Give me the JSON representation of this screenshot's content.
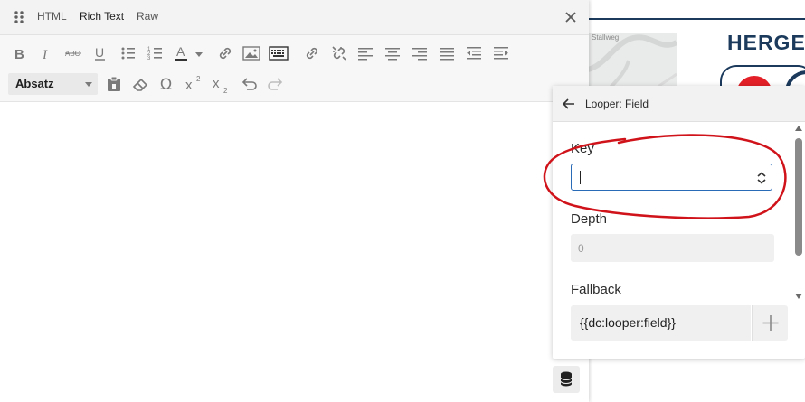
{
  "background": {
    "map_label": "Stallweg",
    "brand_text": "HERGES"
  },
  "editor": {
    "tabs": [
      {
        "label": "HTML",
        "active": false
      },
      {
        "label": "Rich Text",
        "active": true
      },
      {
        "label": "Raw",
        "active": false
      }
    ],
    "toolbar": {
      "format_select": {
        "value": "Absatz"
      },
      "row1_icons": [
        "bold-icon",
        "italic-icon",
        "strikethrough-icon",
        "underline-icon",
        "bulleted-list-icon",
        "numbered-list-icon",
        "text-color-icon",
        "link-icon",
        "image-icon",
        "keyboard-icon",
        "link-icon",
        "unlink-icon",
        "align-left-icon",
        "align-center-icon",
        "align-right-icon",
        "align-justify-icon",
        "outdent-icon",
        "indent-icon"
      ],
      "row2_icons": [
        "paste-text-icon",
        "eraser-icon",
        "omega-icon",
        "superscript-icon",
        "subscript-icon",
        "undo-icon",
        "redo-icon"
      ]
    }
  },
  "panel": {
    "title": "Looper: Field",
    "key": {
      "label": "Key",
      "value": ""
    },
    "depth": {
      "label": "Depth",
      "placeholder": "0"
    },
    "fallback": {
      "label": "Fallback",
      "value": "{{dc:looper:field}}"
    }
  },
  "colors": {
    "focus_border": "#2a6bb8",
    "annotation": "#d0131b",
    "brand": "#1b3a5c"
  }
}
